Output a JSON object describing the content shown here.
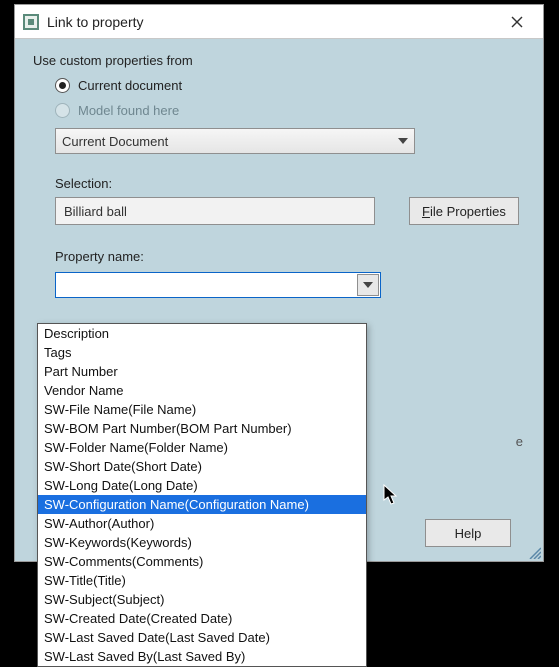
{
  "window": {
    "title": "Link to property"
  },
  "labels": {
    "use_custom": "Use custom properties from",
    "selection": "Selection:",
    "property_name": "Property name:",
    "doc_combo": "Current Document",
    "side_e": "e"
  },
  "radios": {
    "current": "Current document",
    "model": "Model found here"
  },
  "inputs": {
    "selection_value": "Billiard ball",
    "property_value": ""
  },
  "buttons": {
    "file_properties": "File Properties",
    "file_properties_accesskey": "F",
    "help": "Help"
  },
  "dropdown": {
    "items": [
      "Description",
      "Tags",
      "Part Number",
      "Vendor Name",
      "SW-File Name(File Name)",
      "SW-BOM Part Number(BOM Part Number)",
      "SW-Folder Name(Folder Name)",
      "SW-Short Date(Short Date)",
      "SW-Long Date(Long Date)",
      "SW-Configuration Name(Configuration Name)",
      "SW-Author(Author)",
      "SW-Keywords(Keywords)",
      "SW-Comments(Comments)",
      "SW-Title(Title)",
      "SW-Subject(Subject)",
      "SW-Created Date(Created Date)",
      "SW-Last Saved Date(Last Saved Date)",
      "SW-Last Saved By(Last Saved By)"
    ],
    "selected_index": 9
  }
}
